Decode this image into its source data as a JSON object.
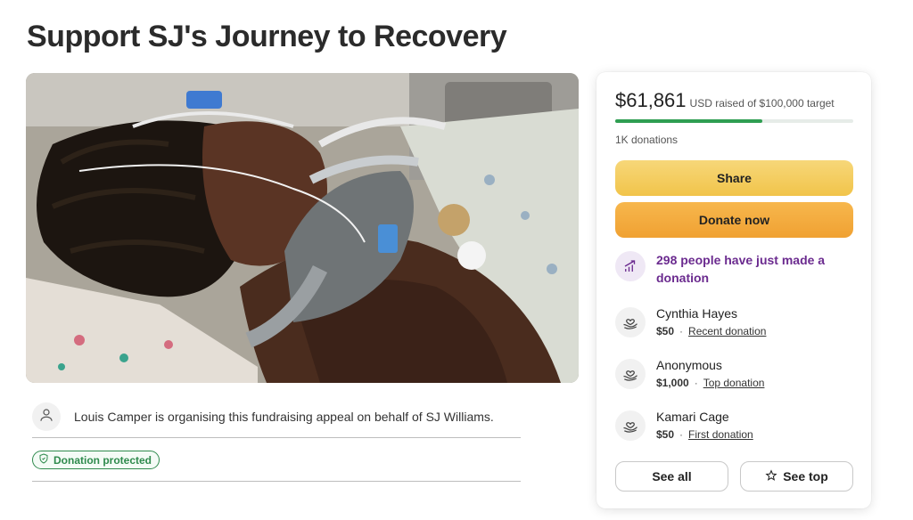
{
  "page": {
    "title": "Support SJ's Journey to Recovery"
  },
  "organiser": {
    "text": "Louis Camper is organising this fundraising appeal on behalf of SJ Williams."
  },
  "badge": {
    "label": "Donation protected"
  },
  "card": {
    "amount": "$61,861",
    "raised_text": "USD raised of $100,000 target",
    "progress_fraction": 0.619,
    "donation_count": "1K donations",
    "share_label": "Share",
    "donate_label": "Donate now",
    "trend_text": "298 people have just made a donation",
    "donors": [
      {
        "name": "Cynthia Hayes",
        "amount": "$50",
        "tag": "Recent donation"
      },
      {
        "name": "Anonymous",
        "amount": "$1,000",
        "tag": "Top donation"
      },
      {
        "name": "Kamari Cage",
        "amount": "$50",
        "tag": "First donation"
      }
    ],
    "see_all_label": "See all",
    "see_top_label": "See top"
  },
  "colors": {
    "accent_green": "#2f9e52",
    "trend_purple": "#6b2b8f",
    "share_yellow": "#f1c44a",
    "donate_orange": "#f0a132"
  },
  "icons": {
    "avatar": "person-icon",
    "badge": "shield-icon",
    "trend": "trending-chart-icon",
    "donor": "donation-hands-heart-icon",
    "see_top": "star-icon"
  }
}
